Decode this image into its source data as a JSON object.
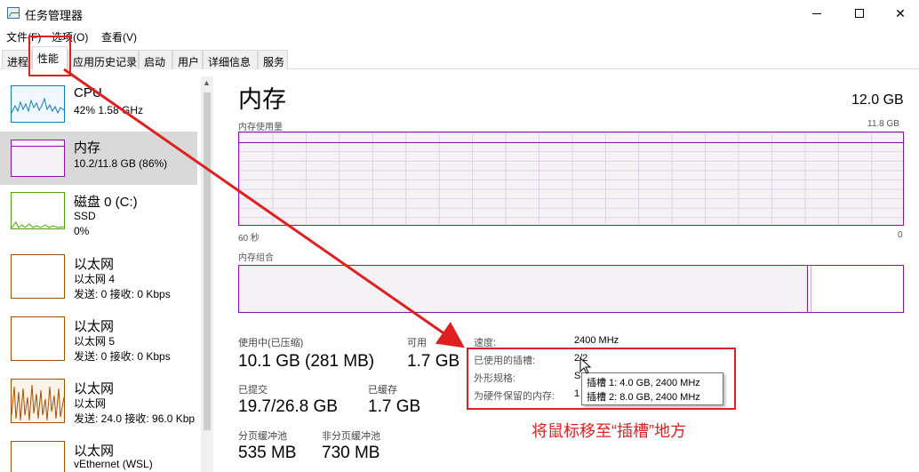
{
  "window": {
    "title": "任务管理器",
    "minimize": "—",
    "maximize": "☐",
    "close": "✕"
  },
  "menu": [
    "文件(F)",
    "选项(O)",
    "查看(V)"
  ],
  "tabs": [
    "进程",
    "性能",
    "应用历史记录",
    "启动",
    "用户",
    "详细信息",
    "服务"
  ],
  "active_tab": "性能",
  "sidebar": {
    "items": [
      {
        "title": "CPU",
        "sub1": "42%  1.58 GHz",
        "sub2": "",
        "color": "#117dbb"
      },
      {
        "title": "内存",
        "sub1": "10.2/11.8 GB (86%)",
        "sub2": "",
        "color": "#8b12ae"
      },
      {
        "title": "磁盘 0 (C:)",
        "sub1": "SSD",
        "sub2": "0%",
        "color": "#4da60c"
      },
      {
        "title": "以太网",
        "sub1": "以太网 4",
        "sub2": "发送: 0 接收: 0 Kbps",
        "color": "#a74f01"
      },
      {
        "title": "以太网",
        "sub1": "以太网 5",
        "sub2": "发送: 0 接收: 0 Kbps",
        "color": "#a74f01"
      },
      {
        "title": "以太网",
        "sub1": "以太网",
        "sub2": "发送: 24.0 接收: 96.0 Kbp",
        "color": "#a74f01"
      },
      {
        "title": "以太网",
        "sub1": "vEthernet (WSL)",
        "sub2": "",
        "color": "#a74f01"
      }
    ]
  },
  "main": {
    "title": "内存",
    "capacity": "12.0 GB",
    "usage_label": "内存使用量",
    "usage_max": "11.8 GB",
    "time_left": "60 秒",
    "time_right": "0",
    "composition_label": "内存组合",
    "in_use_fraction": 0.86
  },
  "stats": {
    "in_use_label": "使用中(已压缩)",
    "in_use_value": "10.1 GB (281 MB)",
    "available_label": "可用",
    "available_value": "1.7 GB",
    "committed_label": "已提交",
    "committed_value": "19.7/26.8 GB",
    "cached_label": "已缓存",
    "cached_value": "1.7 GB",
    "paged_label": "分页缓冲池",
    "paged_value": "535 MB",
    "nonpaged_label": "非分页缓冲池",
    "nonpaged_value": "730 MB"
  },
  "specs": {
    "speed_label": "速度:",
    "speed_value": "2400 MHz",
    "slots_label": "已使用的插槽:",
    "slots_value": "2/2",
    "form_label": "外形规格:",
    "form_value": "S",
    "reserved_label": "为硬件保留的内存:",
    "reserved_value": "1"
  },
  "tooltip": {
    "line1": "插槽 1: 4.0 GB, 2400 MHz",
    "line2": "插槽 2: 8.0 GB, 2400 MHz"
  },
  "annotation": {
    "text": "将鼠标移至“插槽”地方",
    "color": "#e02020"
  }
}
